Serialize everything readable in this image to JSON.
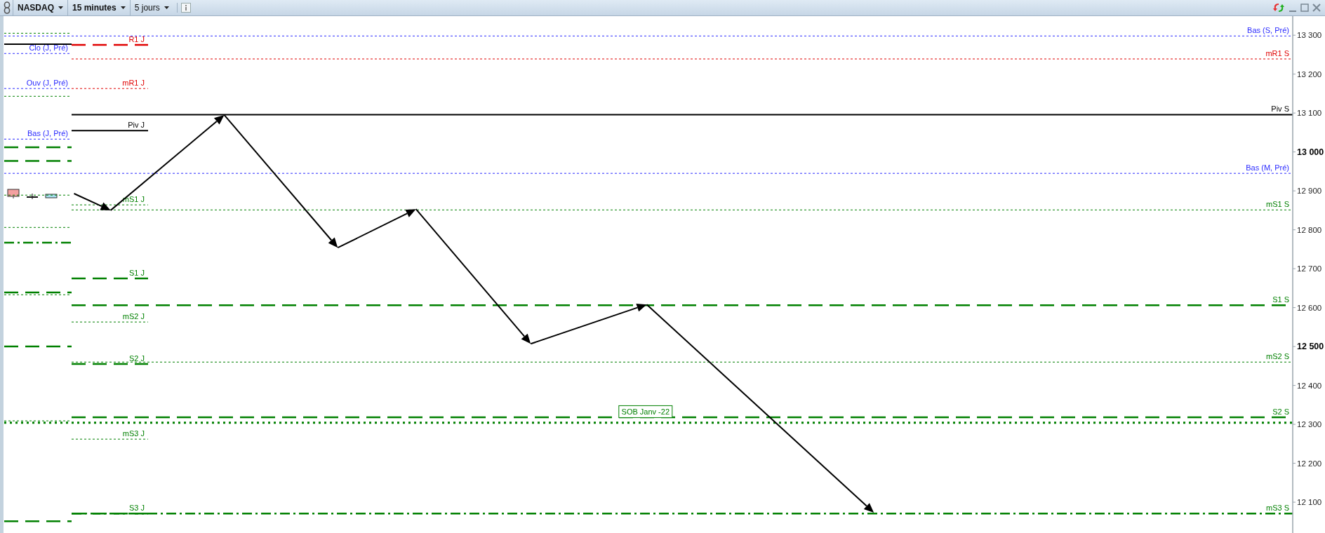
{
  "toolbar": {
    "menus": [
      {
        "label": "NASDAQ",
        "emphasis": true
      },
      {
        "label": "15 minutes",
        "emphasis": true
      },
      {
        "label": "5 jours",
        "emphasis": false
      }
    ]
  },
  "chart": {
    "levels_full": [
      {
        "kind": "dotted",
        "color": "#2a2aff",
        "label": "Bas (S, Pré)"
      },
      {
        "kind": "dotted",
        "color": "#2a2aff",
        "label": "Bas (M, Pré)"
      },
      {
        "kind": "dots"
      }
    ],
    "levels_weekly": [
      {
        "kind": "dotted",
        "color": "#e00000",
        "label": "mR1 S"
      },
      {
        "kind": "solid",
        "color": "#000000",
        "label": "Piv S"
      },
      {
        "kind": "dotted",
        "color": "#008000",
        "label": "mS1 S"
      },
      {
        "kind": "dashed",
        "color": "#008000",
        "label": "S1 S"
      },
      {
        "kind": "dotted",
        "color": "#008000",
        "label": "mS2 S"
      },
      {
        "kind": "dashed",
        "color": "#008000",
        "label": "S2 S"
      },
      {
        "kind": "dashdot",
        "color": "#008000",
        "label": "mS3 S"
      }
    ],
    "levels_daily": [
      {
        "kind": "dashed",
        "color": "#e00000",
        "label": "R1 J"
      },
      {
        "kind": "dotted",
        "color": "#e00000",
        "label": "mR1 J"
      },
      {
        "kind": "solid",
        "color": "#000000",
        "label": "Piv J"
      },
      {
        "kind": "dotted",
        "color": "#008000",
        "label": "mS1 J"
      },
      {
        "kind": "dashed",
        "color": "#008000",
        "label": "S1 J"
      },
      {
        "kind": "dotted",
        "color": "#008000",
        "label": "mS2 J"
      },
      {
        "kind": "dashed",
        "color": "#008000",
        "label": "S2 J"
      },
      {
        "kind": "dotted",
        "color": "#008000",
        "label": "mS3 J"
      },
      {
        "kind": "dashed",
        "color": "#008000",
        "label": "S3 J"
      }
    ],
    "levels_previous": [
      {
        "kind": "dotted"
      },
      {
        "kind": "solid"
      },
      {
        "kind": "dotted",
        "color": "#2a2aff",
        "label": "Clo (J, Pré)"
      },
      {
        "kind": "dotted",
        "color": "#2a2aff",
        "label": "Ouv (J, Pré)"
      },
      {
        "kind": "dotted"
      },
      {
        "kind": "dotted",
        "color": "#2a2aff",
        "label": "Bas (J, Pré)"
      },
      {
        "kind": "dashed"
      },
      {
        "kind": "dashed"
      },
      {
        "kind": "dotted"
      },
      {
        "kind": "dotted"
      },
      {
        "kind": "dashdot"
      },
      {
        "kind": "dashed"
      },
      {
        "kind": "dotted"
      },
      {
        "kind": "dashed"
      },
      {
        "kind": "dotted"
      },
      {
        "kind": "dashed"
      }
    ],
    "tag": {
      "label": "SOB Janv -22",
      "color": "#008000"
    },
    "axis_ticks": [
      {
        "label": "13 300",
        "major": false
      },
      {
        "label": "13 200",
        "major": false
      },
      {
        "label": "13 100",
        "major": false
      },
      {
        "label": "13 000",
        "major": true
      },
      {
        "label": "12 900",
        "major": false
      },
      {
        "label": "12 800",
        "major": false
      },
      {
        "label": "12 700",
        "major": false
      },
      {
        "label": "12 600",
        "major": false
      },
      {
        "label": "12 500",
        "major": true
      },
      {
        "label": "12 400",
        "major": false
      },
      {
        "label": "12 300",
        "major": false
      },
      {
        "label": "12 200",
        "major": false
      },
      {
        "label": "12 100",
        "major": false
      }
    ]
  }
}
